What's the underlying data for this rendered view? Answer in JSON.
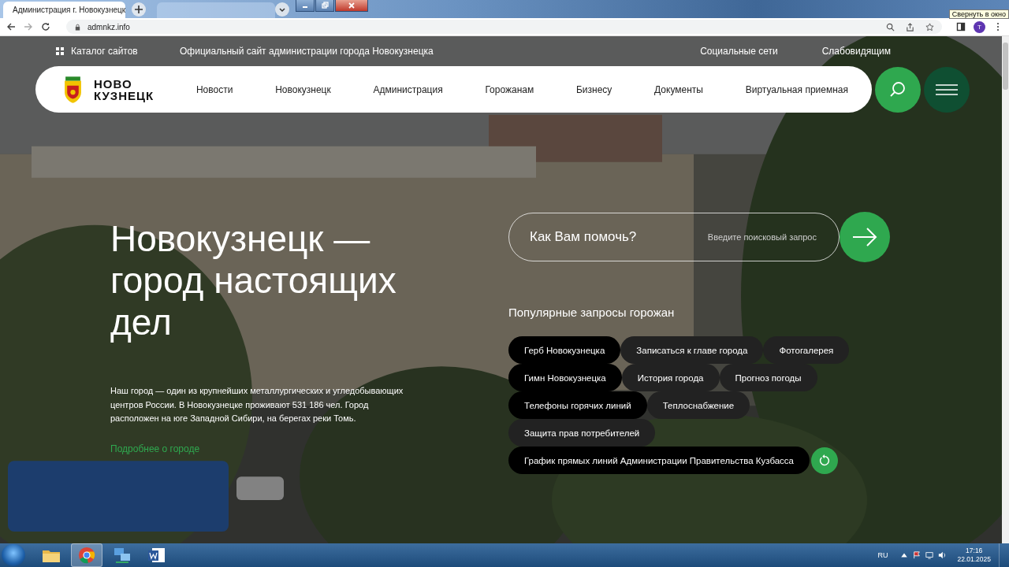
{
  "browser": {
    "tab_title": "Администрация г. Новокузнецк",
    "url": "admnkz.info",
    "profile_initial": "T",
    "tooltip": "Свернуть в окно"
  },
  "topbar": {
    "catalog": "Каталог сайтов",
    "site_title": "Официальный сайт администрации города Новокузнецка",
    "links": [
      "Социальные сети",
      "Слабовидящим"
    ]
  },
  "logo": {
    "line1": "НОВО",
    "line2": "КУЗНЕЦК"
  },
  "nav": [
    "Новости",
    "Новокузнецк",
    "Администрация",
    "Горожанам",
    "Бизнесу",
    "Документы",
    "Виртуальная приемная"
  ],
  "hero": {
    "heading": "Новокузнецк — город настоящих дел",
    "text": "Наш город — один из крупнейших металлургических и угледобывающих центров России. В Новокузнецке проживают 531 186 чел. Город расположен на юге Западной Сибири, на берегах реки Томь.",
    "link": "Подробнее о городе"
  },
  "search": {
    "label": "Как Вам помочь?",
    "placeholder": "Введите поисковый запрос"
  },
  "popular": {
    "title": "Популярные запросы горожан",
    "tags": [
      {
        "label": "Герб Новокузнецка",
        "kind": "dark"
      },
      {
        "label": "Записаться к главе города",
        "kind": "muted"
      },
      {
        "label": "Фотогалерея",
        "kind": "muted"
      },
      {
        "label": "Гимн Новокузнецка",
        "kind": "dark"
      },
      {
        "label": "История города",
        "kind": "muted"
      },
      {
        "label": "Прогноз погоды",
        "kind": "muted"
      },
      {
        "label": "Телефоны горячих линий",
        "kind": "dark"
      },
      {
        "label": "Теплоснабжение",
        "kind": "muted"
      },
      {
        "label": "Защита прав потребителей",
        "kind": "muted"
      },
      {
        "label": "График прямых линий Администрации Правительства Кузбасса",
        "kind": "dark"
      }
    ]
  },
  "taskbar": {
    "language": "RU",
    "time": "17:16",
    "date": "22.01.2025"
  }
}
